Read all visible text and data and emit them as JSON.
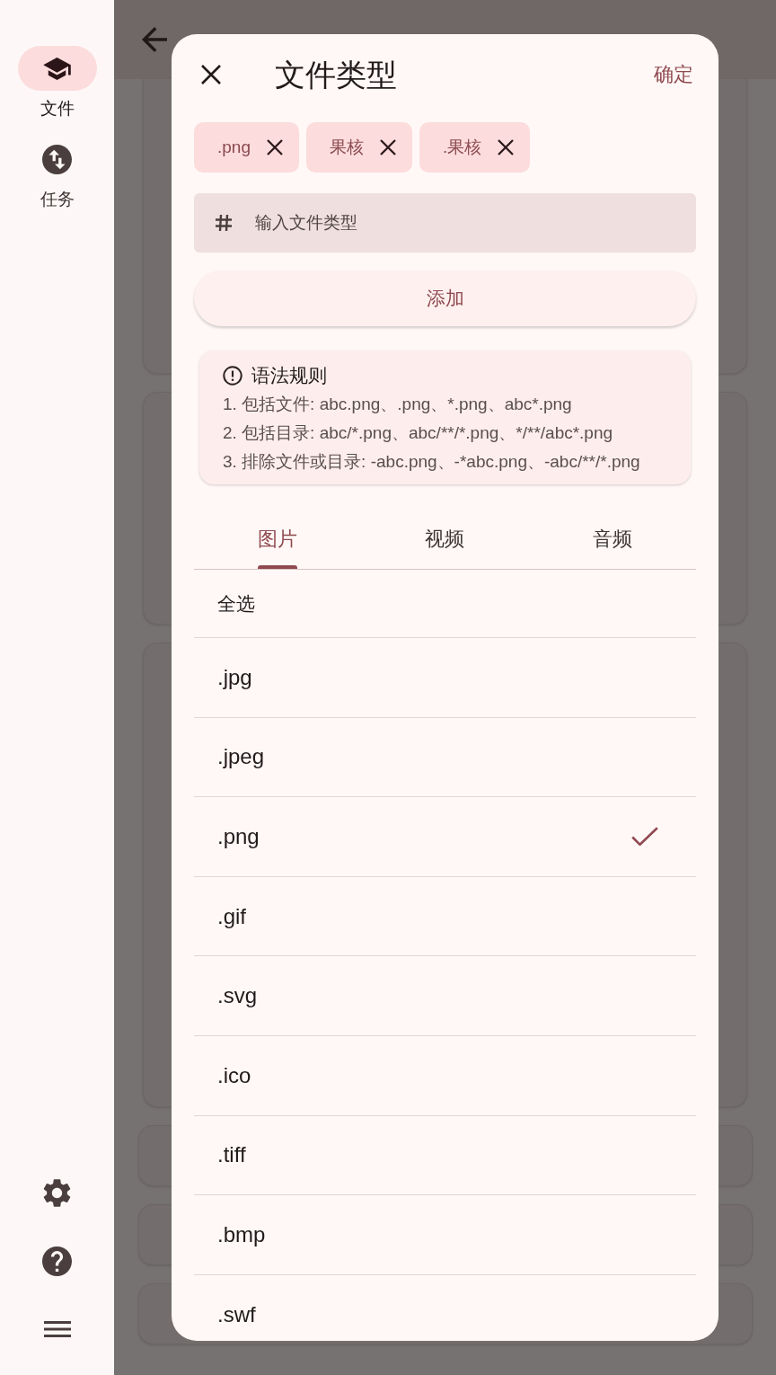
{
  "nav_rail": {
    "items": [
      {
        "label": "文件",
        "selected": true
      },
      {
        "label": "任务",
        "selected": false
      }
    ]
  },
  "dialog": {
    "title": "文件类型",
    "confirm": "确定",
    "chips": [
      ".png",
      "果核",
      ".果核"
    ],
    "input": {
      "placeholder": "输入文件类型"
    },
    "add_button": "添加",
    "rules": {
      "title": "语法规则",
      "lines": [
        "1. 包括文件: abc.png、.png、*.png、abc*.png",
        "2. 包括目录: abc/*.png、abc/**/*.png、*/**/abc*.png",
        "3. 排除文件或目录: -abc.png、-*abc.png、-abc/**/*.png"
      ]
    },
    "tabs": [
      {
        "label": "图片",
        "selected": true
      },
      {
        "label": "视频",
        "selected": false
      },
      {
        "label": "音频",
        "selected": false
      }
    ],
    "select_all": {
      "label": "全选",
      "checked": false
    },
    "options": [
      {
        "label": ".jpg",
        "checked": false
      },
      {
        "label": ".jpeg",
        "checked": false
      },
      {
        "label": ".png",
        "checked": true
      },
      {
        "label": ".gif",
        "checked": false
      },
      {
        "label": ".svg",
        "checked": false
      },
      {
        "label": ".ico",
        "checked": false
      },
      {
        "label": ".tiff",
        "checked": false
      },
      {
        "label": ".bmp",
        "checked": false
      },
      {
        "label": ".swf",
        "checked": false
      }
    ]
  }
}
